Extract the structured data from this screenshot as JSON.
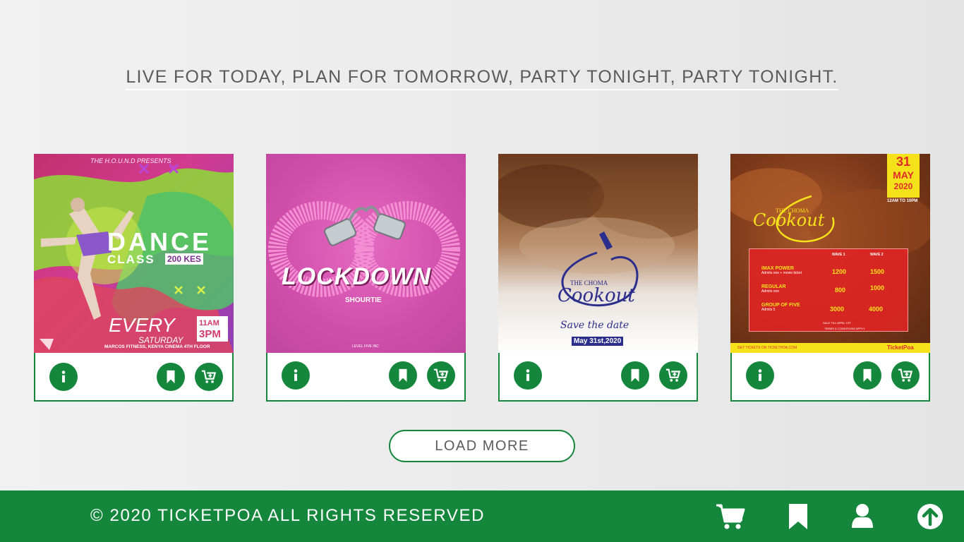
{
  "tagline": "LIVE FOR TODAY, PLAN FOR TOMORROW, PARTY TONIGHT, PARTY TONIGHT.",
  "events": [
    {
      "presents": "THE H.O.U.N.D PRESENTS",
      "title_line1": "DANCE",
      "title_line2": "CLASS",
      "price": "200 KES",
      "schedule": "EVERY",
      "day": "SATURDAY",
      "time_top": "11AM",
      "time_bottom": "3PM",
      "venue": "MARCOS FITNESS, KENYA CINEMA 4TH FLOOR"
    },
    {
      "title": "LOCKDOWN",
      "artist": "SHOURTIE",
      "org": "LEVEL FIVE INC"
    },
    {
      "brand_top": "THE CHOMA",
      "brand_main": "Cookout",
      "save_date": "Save the date",
      "date": "May 31st,2020"
    },
    {
      "date_day": "31",
      "date_month": "MAY",
      "date_year": "2020",
      "hours": "12AM TO 10PM",
      "brand_top": "THE CHOMA",
      "brand_main": "Cookout",
      "wave1": "WAVE 1",
      "wave2": "WAVE 2",
      "tiers": [
        {
          "name": "IMAX POWER",
          "sub": "Admits one + movie ticket",
          "w1": "1200",
          "w2": "1500"
        },
        {
          "name": "REGULAR",
          "sub": "Admits one",
          "w1": "800",
          "w2": "1000"
        },
        {
          "name": "GROUP OF FIVE",
          "sub": "Admits 5",
          "w1": "3000",
          "w2": "4000"
        }
      ],
      "sale_note": "SALE TILL APRIL 1ST",
      "terms": "TERMS & CONDITIONS APPLY",
      "footer_left": "GET TICKETS ON TICKETPOA.COM",
      "footer_brand": "TicketPoa"
    }
  ],
  "load_more": "LOAD MORE",
  "footer": {
    "copyright": "© 2020 TICKETPOA ALL RIGHTS RESERVED"
  },
  "colors": {
    "brand_green": "#14873d",
    "footer_bg": "#14873d"
  },
  "icons": {
    "info": "info-icon",
    "bookmark": "bookmark-icon",
    "cart": "cart-icon",
    "user": "user-icon",
    "scroll_top": "arrow-up-circle-icon"
  }
}
